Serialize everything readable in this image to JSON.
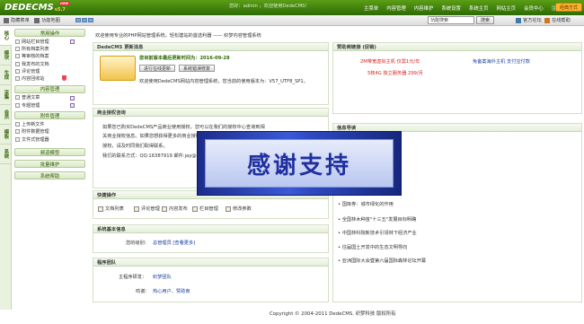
{
  "header": {
    "logo": "DEDECMS",
    "version": "v5.7",
    "new_badge": "new",
    "welcome": "您好：admin ，欢迎使用DedeCMS！",
    "nav": [
      "主菜单",
      "内容发布",
      "系统",
      "模块",
      "生成",
      "采集",
      "会员",
      "模板",
      "系统"
    ],
    "nav_full": [
      "主菜单",
      "内容管理",
      "内容维护",
      "系统设置",
      "系统主页",
      "网站主页",
      "会员中心",
      "注销"
    ],
    "mode": "经典方式"
  },
  "toolbar": {
    "hide_menu": "隐藏菜单",
    "func_map": "功能地图",
    "search_value": "功能搜索",
    "search_button": "搜索",
    "right_links": [
      "官方论坛",
      "在线帮助"
    ]
  },
  "left_tabs": [
    "核心",
    "模块",
    "生成",
    "采集",
    "会员",
    "模板",
    "系统"
  ],
  "sidebar": [
    {
      "title": "常用操作",
      "items": [
        "网站栏目管理",
        "所有档案列表",
        "等审核的档案",
        "我发布的文档",
        "评论管理",
        "内容回收站"
      ]
    },
    {
      "title": "内容管理",
      "items": [
        "普通文章",
        "专题管理"
      ]
    },
    {
      "title": "附件管理",
      "items": [
        "上传新文件",
        "附件数据管理",
        "文件式管理器"
      ]
    },
    {
      "title": "频道模型",
      "items": []
    },
    {
      "title": "批量维护",
      "items": []
    },
    {
      "title": "系统帮助",
      "items": []
    }
  ],
  "intro": "欢迎使用专业的PHP网站管理系统，轻松建站的首选利器 —— 织梦内容管理系统",
  "update": {
    "title": "DedeCMS 更新消息",
    "latest": "您目前版本最后更新时间为：2016-09-28",
    "btn_download": "进行在线更新",
    "btn_check": "系统错误修复",
    "welcome": "欢迎使用DedeCMS网站内容管理系统，您当前的使用版本为：V57_UTF8_SP1。"
  },
  "license": {
    "title": "商业授权咨询",
    "lines": [
      "如果您已购买DedeCMS产品商业使用授权，您可以在我们的授权中心查询到相",
      "关商业授权信息。如果您想获得更多的商业授权服务和更多的商业开发的相关",
      "授权，请及时同我们取得联系。",
      "我们的联系方式：QQ:16387919 邮件:jay@desdev.com"
    ]
  },
  "quick": {
    "title": "快捷操作",
    "items": [
      "文档列表",
      "评论管理",
      "内容发布",
      "栏目管理",
      "修改参数"
    ]
  },
  "sysinfo": {
    "title": "系统基本信息",
    "label": "您的级别：",
    "value": "总管理员 [查看更多]"
  },
  "team": {
    "title": "程序团队",
    "rows": [
      {
        "k": "主程序研发：",
        "v": "织梦团队"
      },
      {
        "k": "鸣谢：",
        "v": "热心用户、赞助商"
      }
    ]
  },
  "ads": {
    "title": "赞助商链接 (促销)",
    "links": [
      "2M带宽虚拟主机 仅需1元/年",
      "免备案海外主机 支付宝付款",
      "5核4G 独立服务器 299/月"
    ]
  },
  "news": {
    "title": "信息导读",
    "items": [
      "国库券：城市绿化的作用",
      "全国林木种苗\"十三五\"发展目标明确",
      "中国林科院新技术引领林下经济产业",
      "往届国土开发中的生态文明导向",
      "亚洲国际大会暨第六届国际森林论坛开幕"
    ]
  },
  "overlay": "感谢支持",
  "footer": "Copyright © 2004-2011 DedeCMS. 织梦科技 版权所有",
  "colors": {
    "brand_green": "#3f7a0a",
    "mode_orange": "#ffb52e",
    "overlay_blue": "#2f49c1"
  }
}
